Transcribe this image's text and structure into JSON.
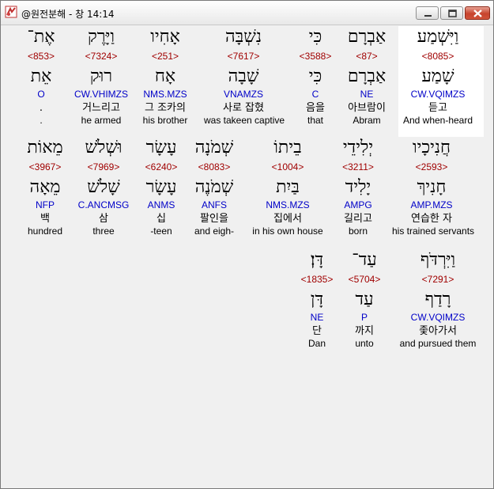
{
  "window": {
    "title": "@원전분해 - 창 14:14",
    "icon": "app-icon",
    "controls": [
      "minimize-icon",
      "maximize-icon",
      "close-icon"
    ]
  },
  "rows": [
    [
      {
        "heb": "וַיִּשְׁמַע",
        "strong": "<8085>",
        "lemma": "שָׁמַע",
        "morph": "CW.VQIMZS",
        "kor": "듣고",
        "eng": "And when-heard",
        "selected": true
      },
      {
        "heb": "אַבְרָם",
        "strong": "<87>",
        "lemma": "אַבְרָם",
        "morph": "NE",
        "kor": "아브람이",
        "eng": "Abram"
      },
      {
        "heb": "כִּי",
        "strong": "<3588>",
        "lemma": "כִּי",
        "morph": "C",
        "kor": "음을",
        "eng": "that"
      },
      {
        "heb": "נִשְׁבָּה",
        "strong": "<7617>",
        "lemma": "שָׁבָה",
        "morph": "VNAMZS",
        "kor": "사로 잡혔",
        "eng": "was takeen captive"
      },
      {
        "heb": "אָחִיו",
        "strong": "<251>",
        "lemma": "אָח",
        "morph": "NMS.MZS",
        "kor": "그 조카의",
        "eng": "his brother"
      },
      {
        "heb": "וַיָּרֶק",
        "strong": "<7324>",
        "lemma": "רוּק",
        "morph": "CW.VHIMZS",
        "kor": "거느리고",
        "eng": "he armed"
      },
      {
        "heb": "אֶת־",
        "strong": "<853>",
        "lemma": "אֵת",
        "morph": "O",
        "kor": ".",
        "eng": "."
      }
    ],
    [
      {
        "heb": "חֲנִיכָיו",
        "strong": "<2593>",
        "lemma": "חָנִיךְ",
        "morph": "AMP.MZS",
        "kor": "연습한 자",
        "eng": "his trained servants"
      },
      {
        "heb": "יְלִידֵי",
        "strong": "<3211>",
        "lemma": "יָלִיד",
        "morph": "AMPG",
        "kor": "길리고",
        "eng": "born"
      },
      {
        "heb": "בֵיתוֹ",
        "strong": "<1004>",
        "lemma": "בַּיִת",
        "morph": "NMS.MZS",
        "kor": "집에서",
        "eng": "in his own house"
      },
      {
        "heb": "שְׁמֹנָה",
        "strong": "<8083>",
        "lemma": "שְׁמֹנֶה",
        "morph": "ANFS",
        "kor": "팔인을",
        "eng": "and eigh-"
      },
      {
        "heb": "עָשָׂר",
        "strong": "<6240>",
        "lemma": "עָשָׂר",
        "morph": "ANMS",
        "kor": "십",
        "eng": "-teen"
      },
      {
        "heb": "וּשְׁלֹשׁ",
        "strong": "<7969>",
        "lemma": "שָׁלֹשׁ",
        "morph": "C.ANCMSG",
        "kor": "삼",
        "eng": "three"
      },
      {
        "heb": "מֵאוֹת",
        "strong": "<3967>",
        "lemma": "מֵאָה",
        "morph": "NFP",
        "kor": "백",
        "eng": "hundred"
      }
    ],
    [
      {
        "heb": "וַיִּרְדֹּף",
        "strong": "<7291>",
        "lemma": "רָדַף",
        "morph": "CW.VQIMZS",
        "kor": "좇아가서",
        "eng": "and pursued them"
      },
      {
        "heb": "עַד־",
        "strong": "<5704>",
        "lemma": "עַד",
        "morph": "P",
        "kor": "까지",
        "eng": "unto"
      },
      {
        "heb": "דָּן׃",
        "strong": "<1835>",
        "lemma": "דָּן",
        "morph": "NE",
        "kor": "단",
        "eng": "Dan"
      }
    ]
  ]
}
